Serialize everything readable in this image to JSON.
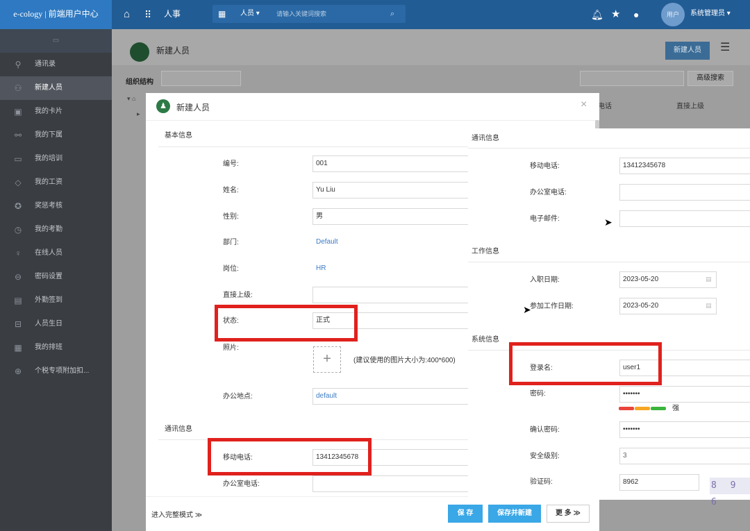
{
  "app": {
    "logo_text": "e-cology | 前端用户中心",
    "module_label": "人事"
  },
  "search": {
    "scope_label": "人员",
    "placeholder": "请输入关键词搜索"
  },
  "user": {
    "avatar_text": "用户",
    "name": "系统管理员"
  },
  "sidebar": {
    "items": [
      {
        "label": "通讯录",
        "icon": "search-icon"
      },
      {
        "label": "新建人员",
        "icon": "user-icon"
      },
      {
        "label": "我的卡片",
        "icon": "card-icon"
      },
      {
        "label": "我的下属",
        "icon": "org-icon"
      },
      {
        "label": "我的培训",
        "icon": "monitor-icon"
      },
      {
        "label": "我的工资",
        "icon": "tag-icon"
      },
      {
        "label": "奖惩考核",
        "icon": "award-icon"
      },
      {
        "label": "我的考勤",
        "icon": "clock-icon"
      },
      {
        "label": "在线人员",
        "icon": "bulb-icon"
      },
      {
        "label": "密码设置",
        "icon": "lock-icon"
      },
      {
        "label": "外勤签到",
        "icon": "doc-icon"
      },
      {
        "label": "人员生日",
        "icon": "cake-icon"
      },
      {
        "label": "我的排班",
        "icon": "calendar-icon"
      },
      {
        "label": "个税专项附加扣...",
        "icon": "tax-icon"
      }
    ]
  },
  "bg_page": {
    "title": "新建人员",
    "new_button": "新建人员",
    "org_label": "组织结构",
    "advanced_search": "高级搜索",
    "col_phone": "电话",
    "col_superior": "直接上级"
  },
  "dialog": {
    "title": "新建人员",
    "basic_section": "基本信息",
    "fields": {
      "number": {
        "label": "编号:",
        "value": "001"
      },
      "name": {
        "label": "姓名:",
        "value": "Yu Liu"
      },
      "gender": {
        "label": "性别:",
        "value": "男"
      },
      "department": {
        "label": "部门:",
        "value": "Default"
      },
      "position": {
        "label": "岗位:",
        "value": "HR"
      },
      "superior": {
        "label": "直接上级:",
        "value": ""
      },
      "status": {
        "label": "状态:",
        "value": "正式"
      },
      "photo": {
        "label": "照片:",
        "hint": "(建议使用的图片大小为:400*600)"
      },
      "office": {
        "label": "办公地点:",
        "value": "default"
      }
    },
    "contact_section": "通讯信息",
    "contact": {
      "mobile": {
        "label": "移动电话:",
        "value": "13412345678"
      },
      "office_phone": {
        "label": "办公室电话:",
        "value": ""
      }
    },
    "footer": {
      "full_mode": "进入完整模式",
      "save": "保 存",
      "save_new": "保存并新建",
      "more": "更 多"
    }
  },
  "overlay": {
    "contact_section": "通讯信息",
    "mobile": {
      "label": "移动电话:",
      "value": "13412345678"
    },
    "office_phone": {
      "label": "办公室电话:",
      "value": ""
    },
    "email": {
      "label": "电子邮件:",
      "value": ""
    },
    "work_section": "工作信息",
    "entry_date": {
      "label": "入职日期:",
      "value": "2023-05-20"
    },
    "work_date": {
      "label": "参加工作日期:",
      "value": "2023-05-20"
    },
    "system_section": "系统信息",
    "login": {
      "label": "登录名:",
      "value": "user1"
    },
    "password": {
      "label": "密码:",
      "value": "•••••••",
      "strength": "强"
    },
    "confirm_password": {
      "label": "确认密码:",
      "value": "•••••••"
    },
    "security_level": {
      "label": "安全级别:",
      "value": "3"
    },
    "captcha": {
      "label": "验证码:",
      "value": "8962",
      "image_text": "8 9 6"
    }
  }
}
